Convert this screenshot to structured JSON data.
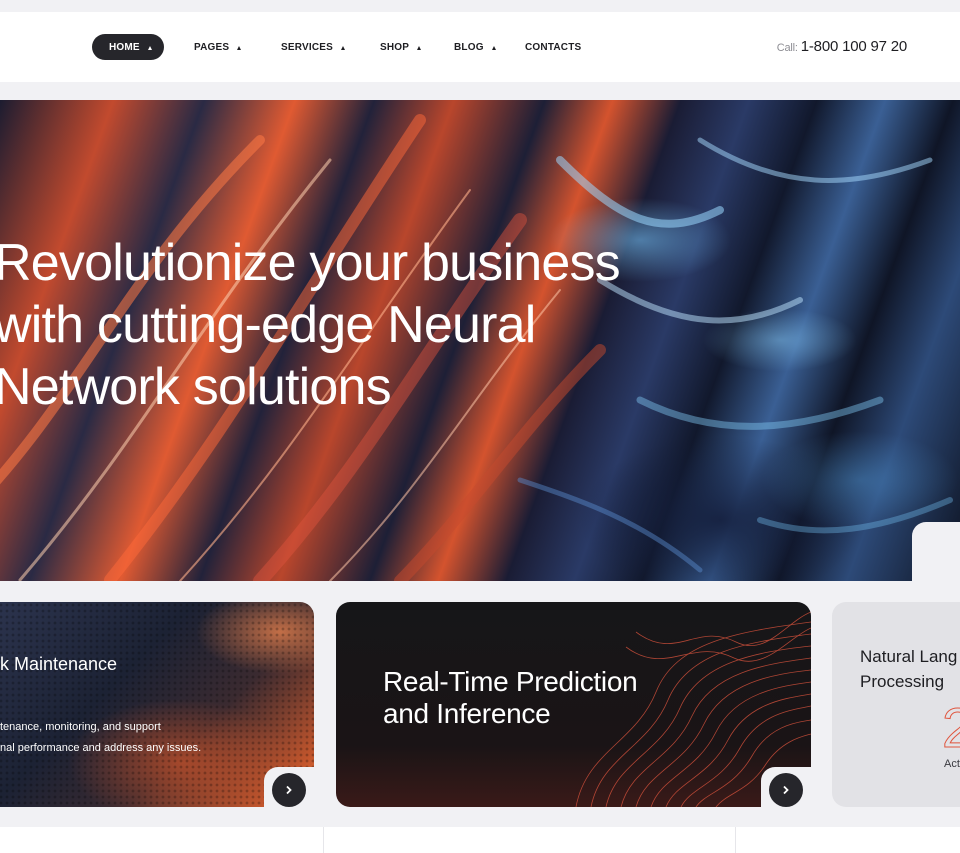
{
  "nav": {
    "items": [
      {
        "label": "HOME",
        "dropdown": true,
        "active": true
      },
      {
        "label": "PAGES",
        "dropdown": true
      },
      {
        "label": "SERVICES",
        "dropdown": true
      },
      {
        "label": "SHOP",
        "dropdown": true
      },
      {
        "label": "BLOG",
        "dropdown": true
      },
      {
        "label": "CONTACTS",
        "dropdown": false
      }
    ]
  },
  "header": {
    "call_label": "Call:",
    "phone": "1-800 100 97 20"
  },
  "hero": {
    "title_line1": "Revolutionize your business",
    "title_line2": "with cutting-edge Neural",
    "title_line3": "Network solutions"
  },
  "cards": {
    "maintenance": {
      "title": "k Maintenance",
      "text_line1": "tenance, monitoring, and support",
      "text_line2": "nal performance and address any issues."
    },
    "prediction": {
      "title_line1": "Real-Time Prediction",
      "title_line2": "and Inference"
    },
    "nlp": {
      "title_line1": "Natural Lang",
      "title_line2": "Processing",
      "number": "2",
      "label": "Act"
    }
  },
  "colors": {
    "accent_dark": "#26262b",
    "accent_orange": "#e0553e",
    "background": "#f1f1f4"
  },
  "icons": {
    "arrow": "chevron-right-icon",
    "dropdown": "caret-up-icon"
  }
}
